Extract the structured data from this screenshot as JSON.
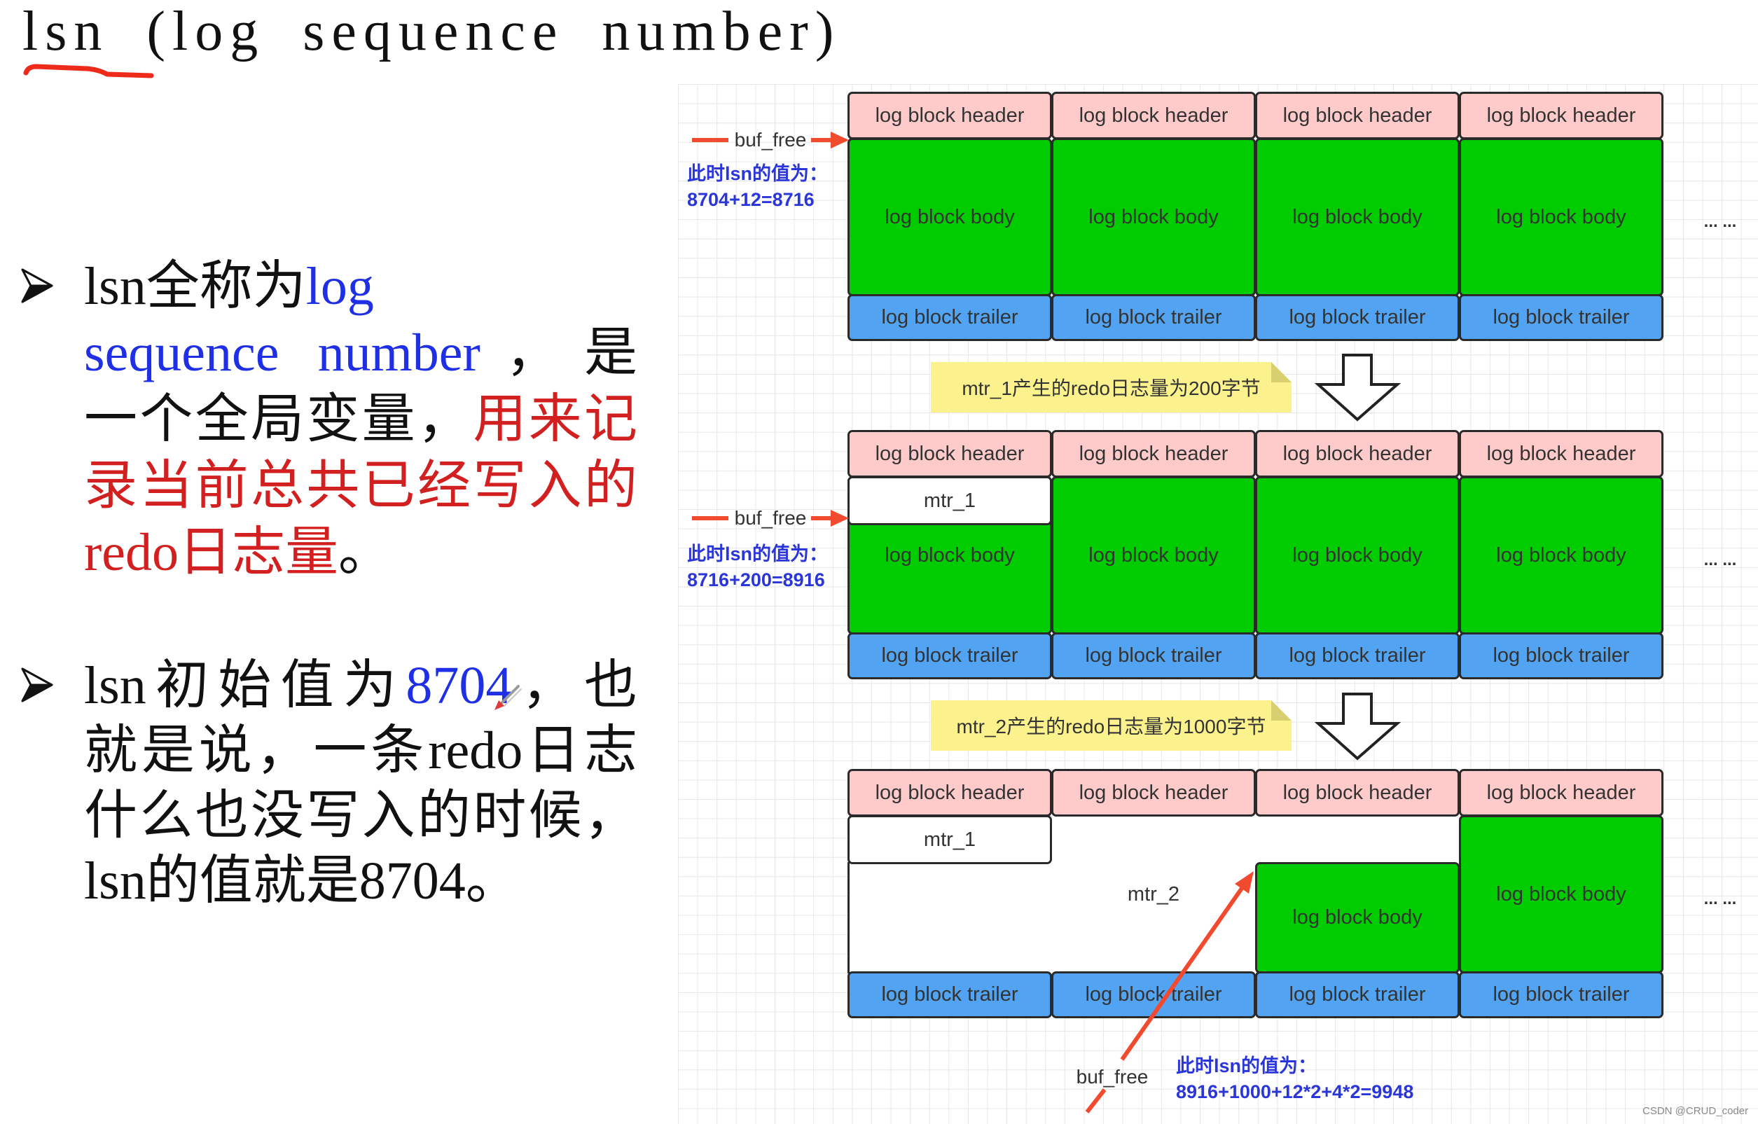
{
  "title": "lsn (log sequence number)",
  "colors": {
    "text": "#111111",
    "highlight_blue": "#1f2fe6",
    "highlight_red": "#d21f1f",
    "title_underline": "#ee2a1a",
    "header_fill": "#ffcaca",
    "body_fill": "#00cc00",
    "trailer_fill": "#52a4f2",
    "note_fill": "#fbf28d",
    "annotation_blue": "#2b36d9",
    "pointer_red": "#f24a2f"
  },
  "bullets": [
    {
      "lines": [
        [
          {
            "text": "lsn全称为",
            "color": "text"
          },
          {
            "text": "log",
            "color": "highlight_blue"
          }
        ],
        [
          {
            "text": "sequence number",
            "color": "highlight_blue"
          },
          {
            "text": "，是",
            "color": "text"
          }
        ],
        [
          {
            "text": "一个全局变量，",
            "color": "text"
          },
          {
            "text": "用来记",
            "color": "highlight_red"
          }
        ],
        [
          {
            "text": "录当前总共已经写入的",
            "color": "highlight_red"
          }
        ],
        [
          {
            "text": "redo日志量",
            "color": "highlight_red"
          },
          {
            "text": "。",
            "color": "text"
          }
        ]
      ]
    },
    {
      "lines": [
        [
          {
            "text": "lsn初始值为",
            "color": "text"
          },
          {
            "text": "8704",
            "color": "highlight_blue"
          },
          {
            "text": "，也",
            "color": "text"
          }
        ],
        [
          {
            "text": "就是说，一条redo日志",
            "color": "text"
          }
        ],
        [
          {
            "text": "什么也没写入的时候，",
            "color": "text"
          }
        ],
        [
          {
            "text": "lsn的值就是8704。",
            "color": "text"
          }
        ]
      ]
    }
  ],
  "diagram": {
    "labels": {
      "header": "log block header",
      "body": "log block body",
      "trailer": "log block trailer",
      "mtr_1": "mtr_1",
      "mtr_2": "mtr_2",
      "ellipsis": "... ..."
    },
    "stages": [
      {
        "pointer_label": "buf_free",
        "lsn_caption": "此时lsn的值为：",
        "lsn_formula": "8704+12=8716"
      },
      {
        "pointer_label": "buf_free",
        "lsn_caption": "此时lsn的值为：",
        "lsn_formula": "8716+200=8916"
      },
      {
        "pointer_label": "buf_free",
        "lsn_caption": "此时lsn的值为：",
        "lsn_formula": "8916+1000+12*2+4*2=9948"
      }
    ],
    "transitions": [
      {
        "note": "mtr_1产生的redo日志量为200字节"
      },
      {
        "note": "mtr_2产生的redo日志量为1000字节"
      }
    ]
  },
  "watermark": "CSDN @CRUD_coder"
}
